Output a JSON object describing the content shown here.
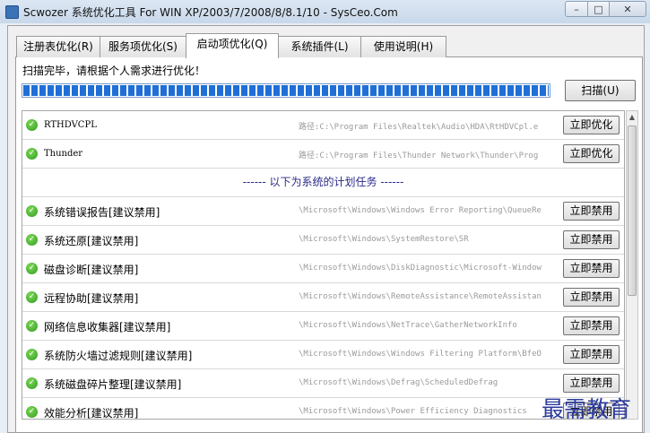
{
  "window": {
    "title": "Scwozer 系统优化工具 For WIN XP/2003/7/2008/8/8.1/10 - SysCeo.Com",
    "min_glyph": "–",
    "max_glyph": "□",
    "close_glyph": "✕"
  },
  "tabs": [
    {
      "label": "注册表优化(R)"
    },
    {
      "label": "服务项优化(S)"
    },
    {
      "label": "启动项优化(Q)"
    },
    {
      "label": "系统插件(L)"
    },
    {
      "label": "使用说明(H)"
    }
  ],
  "active_tab": 2,
  "status_text": "扫描完毕，请根据个人需求进行优化！",
  "progress_percent": 100,
  "scan_button": "扫描(U)",
  "rows": [
    {
      "name": "RTHDVCPL",
      "path": "路径:C:\\Program Files\\Realtek\\Audio\\HDA\\RtHDVCpl.e",
      "action": "立即优化"
    },
    {
      "name": "Thunder",
      "path": "路径:C:\\Program Files\\Thunder Network\\Thunder\\Prog",
      "action": "立即优化"
    }
  ],
  "section_header": "------ 以下为系统的计划任务 ------",
  "tasks": [
    {
      "name": "系统错误报告[建议禁用]",
      "path": "\\Microsoft\\Windows\\Windows Error Reporting\\QueueRe",
      "action": "立即禁用"
    },
    {
      "name": "系统还原[建议禁用]",
      "path": "\\Microsoft\\Windows\\SystemRestore\\SR",
      "action": "立即禁用"
    },
    {
      "name": "磁盘诊断[建议禁用]",
      "path": "\\Microsoft\\Windows\\DiskDiagnostic\\Microsoft-Window",
      "action": "立即禁用"
    },
    {
      "name": "远程协助[建议禁用]",
      "path": "\\Microsoft\\Windows\\RemoteAssistance\\RemoteAssistan",
      "action": "立即禁用"
    },
    {
      "name": "网络信息收集器[建议禁用]",
      "path": "\\Microsoft\\Windows\\NetTrace\\GatherNetworkInfo",
      "action": "立即禁用"
    },
    {
      "name": "系统防火墙过滤规则[建议禁用]",
      "path": "\\Microsoft\\Windows\\Windows Filtering Platform\\BfeO",
      "action": "立即禁用"
    },
    {
      "name": "系统磁盘碎片整理[建议禁用]",
      "path": "\\Microsoft\\Windows\\Defrag\\ScheduledDefrag",
      "action": "立即禁用"
    },
    {
      "name": "效能分析[建议禁用]",
      "path": "\\Microsoft\\Windows\\Power Efficiency Diagnostics",
      "action": "立即禁用"
    }
  ],
  "watermark": "最需教育"
}
